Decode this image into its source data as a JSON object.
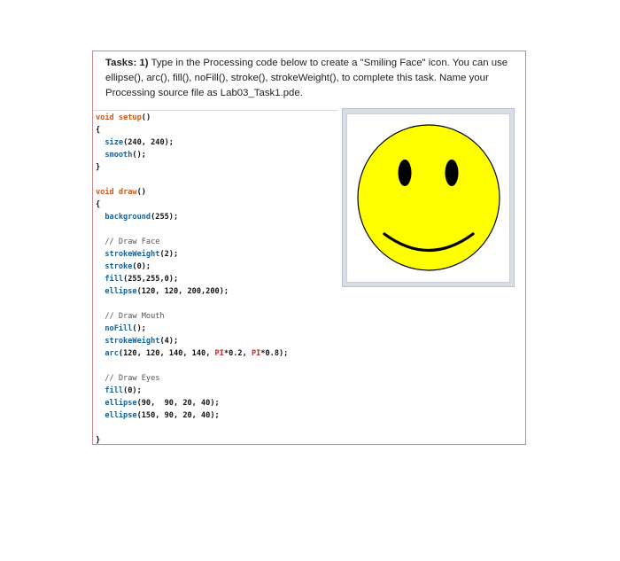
{
  "task": {
    "label": "Tasks: 1)",
    "text": " Type in the Processing code below to create a \"Smiling Face\" icon. You can use ellipse(), arc(), fill(), noFill(), stroke(), strokeWeight(), to complete this task. Name your Processing source file as Lab03_Task1.pde."
  },
  "code": {
    "l1": [
      "void",
      " ",
      "setup",
      "()"
    ],
    "l2": "{",
    "l3": [
      "  ",
      "size",
      "(240, 240);"
    ],
    "l4": [
      "  ",
      "smooth",
      "();"
    ],
    "l5": "}",
    "l6": [
      "void",
      " ",
      "draw",
      "()"
    ],
    "l7": "{",
    "l8": [
      "  ",
      "background",
      "(255);"
    ],
    "l9": "  // Draw Face",
    "l10": [
      "  ",
      "strokeWeight",
      "(2);"
    ],
    "l11": [
      "  ",
      "stroke",
      "(0);"
    ],
    "l12": [
      "  ",
      "fill",
      "(255,255,0);"
    ],
    "l13": [
      "  ",
      "ellipse",
      "(120, 120, 200,200);"
    ],
    "l14": "  // Draw Mouth",
    "l15": [
      "  ",
      "noFill",
      "();"
    ],
    "l16": [
      "  ",
      "strokeWeight",
      "(4);"
    ],
    "l17": [
      "  ",
      "arc",
      "(120, 120, 140, 140, ",
      "PI",
      "*0.2, ",
      "PI",
      "*0.8);"
    ],
    "l18": "  // Draw Eyes",
    "l19": [
      "  ",
      "fill",
      "(0);"
    ],
    "l20": [
      "  ",
      "ellipse",
      "(90,  90, 20, 40);"
    ],
    "l21": [
      "  ",
      "ellipse",
      "(150, 90, 20, 40);"
    ],
    "l22": "}"
  },
  "colors": {
    "face": "#ffff00",
    "outline": "#000000",
    "card_border": "#c9898e",
    "keyword": "#cc5a1c",
    "function": "#1a5f94",
    "constant": "#d0202a"
  },
  "icons": {
    "preview": "smiley-face-icon"
  }
}
